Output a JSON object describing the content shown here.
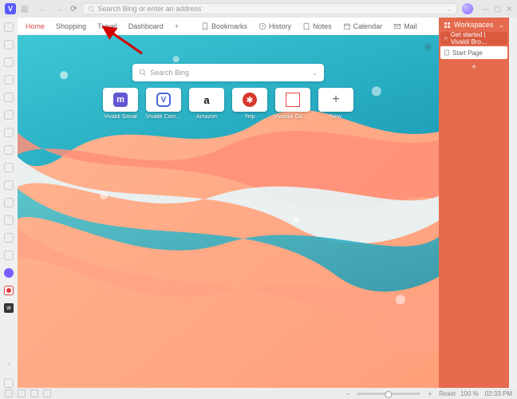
{
  "chrome": {
    "address_placeholder": "Search Bing or enter an address"
  },
  "navbar": {
    "links": [
      "Home",
      "Shopping",
      "Travel",
      "Dashboard"
    ],
    "utils": {
      "bookmarks": "Bookmarks",
      "history": "History",
      "notes": "Notes",
      "calendar": "Calendar",
      "mail": "Mail"
    }
  },
  "startpage": {
    "search_placeholder": "Search Bing",
    "tiles": [
      {
        "label": "Vivaldi Social",
        "icon": "mastodon"
      },
      {
        "label": "Vivaldi Com…",
        "icon": "vivaldi"
      },
      {
        "label": "Amazon",
        "icon": "amazon"
      },
      {
        "label": "Yelp",
        "icon": "yelp"
      },
      {
        "label": "Vivaldia Games",
        "icon": "vivaldia"
      },
      {
        "label": "New",
        "icon": "plus"
      }
    ]
  },
  "workspaces": {
    "title": "Workspaces",
    "items": [
      {
        "label": "Get started | Vivaldi Bro…",
        "active": false
      },
      {
        "label": "Start Page",
        "active": true
      }
    ]
  },
  "status": {
    "reset": "Reset",
    "zoom": "100 %",
    "clock": "02:33 PM"
  }
}
